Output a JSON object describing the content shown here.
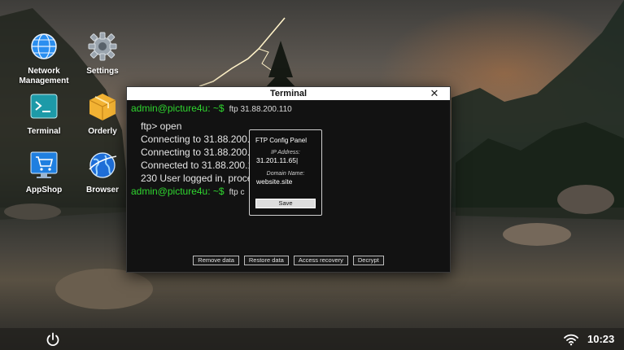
{
  "desktop": {
    "icons": [
      {
        "label": "Network\nManagement",
        "icon": "network-globe-icon"
      },
      {
        "label": "Settings",
        "icon": "gear-icon"
      },
      {
        "label": "Terminal",
        "icon": "terminal-icon"
      },
      {
        "label": "Orderly",
        "icon": "package-box-icon"
      },
      {
        "label": "AppShop",
        "icon": "shopping-cart-icon"
      },
      {
        "label": "Browser",
        "icon": "globe-browser-icon"
      }
    ]
  },
  "terminal": {
    "title": "Terminal",
    "close_label": "✕",
    "lines": [
      {
        "type": "prompt",
        "prompt": "admin@picture4u: ~$",
        "command": "ftp 31.88.200.110"
      },
      {
        "type": "output",
        "text": "ftp> open"
      },
      {
        "type": "output",
        "text": "Connecting to 31.88.200."
      },
      {
        "type": "output",
        "text": "Connecting to 31.88.200."
      },
      {
        "type": "output",
        "text": "Connected to 31.88.200.1"
      },
      {
        "type": "output",
        "text": "230 User logged in, proce"
      },
      {
        "type": "prompt",
        "prompt": "admin@picture4u: ~$",
        "command": "ftp c"
      }
    ],
    "buttons": [
      "Remove data",
      "Restore data",
      "Access recovery",
      "Decrypt"
    ]
  },
  "ftp_panel": {
    "title": "FTP Config Panel",
    "ip_label": "IP Address:",
    "ip_value": "31.201.11.65",
    "domain_label": "Domain Name:",
    "domain_value": "website.site",
    "save_label": "Save"
  },
  "taskbar": {
    "clock": "10:23",
    "power_icon": "power-icon",
    "wifi_icon": "wifi-icon"
  },
  "colors": {
    "prompt_green": "#2fd62f",
    "terminal_bg": "#121212",
    "titlebar_bg": "#ffffff"
  }
}
